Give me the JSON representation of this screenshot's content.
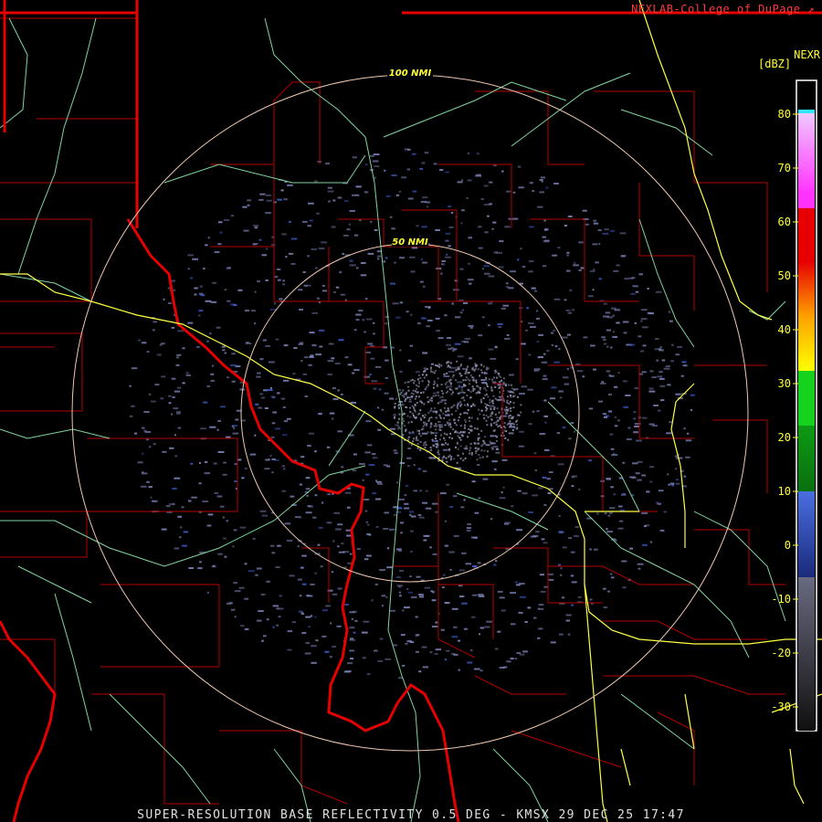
{
  "header": {
    "credit": "NEXLAB-College of DuPage",
    "credit_icon": "external-link-icon",
    "product": "NEXR",
    "unit": "[dBZ]"
  },
  "range_rings": [
    {
      "label": "100 NMI",
      "range_nmi": 100
    },
    {
      "label": "50 NMI",
      "range_nmi": 50
    }
  ],
  "color_scale": {
    "ticks": [
      "80",
      "70",
      "60",
      "50",
      "40",
      "30",
      "20",
      "10",
      "0",
      "-10",
      "-20",
      "-30"
    ],
    "colors": {
      "frame": "#ffffff",
      "grey_low": "#5a5a6e",
      "blue": "#3b5cc8",
      "green": "#14d21e",
      "yellow": "#ffff00",
      "orange": "#ff7800",
      "red": "#e60000",
      "magenta": "#ff32ff",
      "cyan": "#32e6ff"
    }
  },
  "map_colors": {
    "state_border": "#e60000",
    "county_border": "#b40000",
    "highway": "#ffff44",
    "river": "#7fd6a0",
    "ring": "#f0c8b0",
    "echo": "#7a80b4"
  },
  "footer": {
    "text": "SUPER-RESOLUTION BASE REFLECTIVITY 0.5 DEG - KMSX 29 DEC 25 17:47"
  }
}
